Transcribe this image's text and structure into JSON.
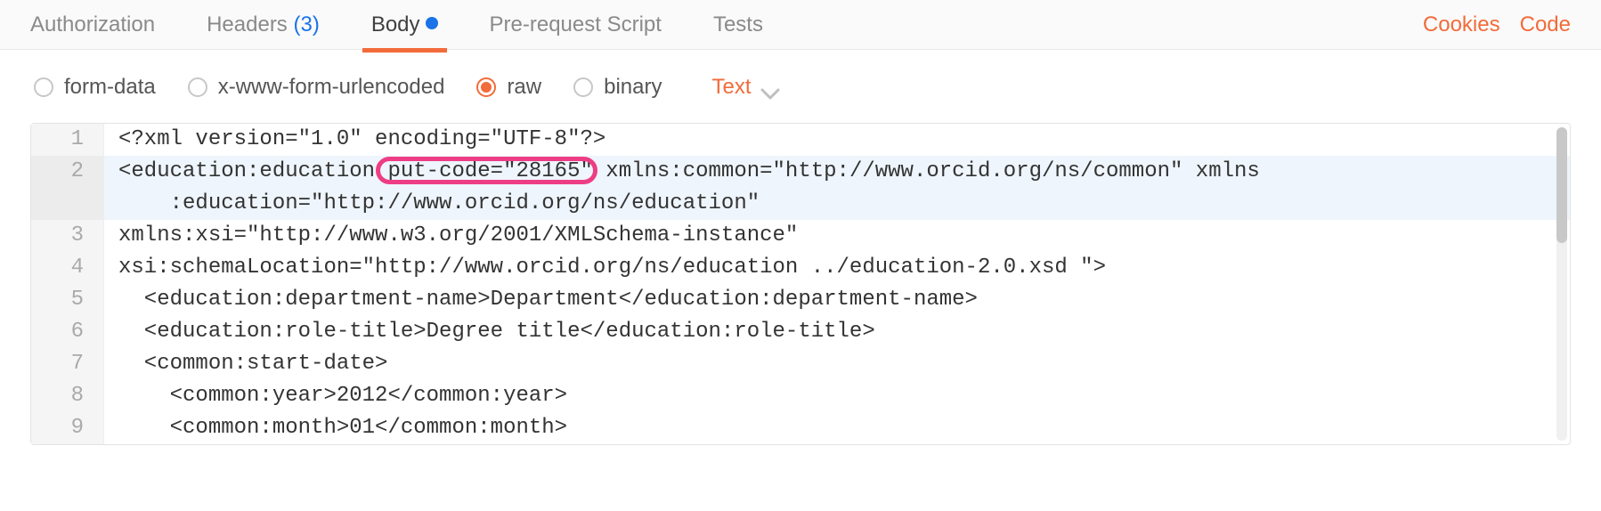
{
  "tabs": {
    "authorization": "Authorization",
    "headers_label": "Headers",
    "headers_count": "(3)",
    "body": "Body",
    "prerequest": "Pre-request Script",
    "tests": "Tests"
  },
  "links": {
    "cookies": "Cookies",
    "code": "Code"
  },
  "bodytypes": {
    "form": "form-data",
    "urlenc": "x-www-form-urlencoded",
    "raw": "raw",
    "binary": "binary"
  },
  "format": "Text",
  "code_lines": {
    "l1": "<?xml version=\"1.0\" encoding=\"UTF-8\"?>",
    "l2a": "<education:education ",
    "l2b": "put-code=\"28165\"",
    "l2c": " xmlns:common=\"http://www.orcid.org/ns/common\" xmlns",
    "l2w": "    :education=\"http://www.orcid.org/ns/education\"",
    "l3": "xmlns:xsi=\"http://www.w3.org/2001/XMLSchema-instance\"",
    "l4": "xsi:schemaLocation=\"http://www.orcid.org/ns/education ../education-2.0.xsd \">",
    "l5": "  <education:department-name>Department</education:department-name>",
    "l6": "  <education:role-title>Degree title</education:role-title>",
    "l7": "  <common:start-date>",
    "l8": "    <common:year>2012</common:year>",
    "l9": "    <common:month>01</common:month>"
  },
  "gutter": {
    "g1": "1",
    "g2": "2",
    "g3": "3",
    "g4": "4",
    "g5": "5",
    "g6": "6",
    "g7": "7",
    "g8": "8",
    "g9": "9"
  }
}
